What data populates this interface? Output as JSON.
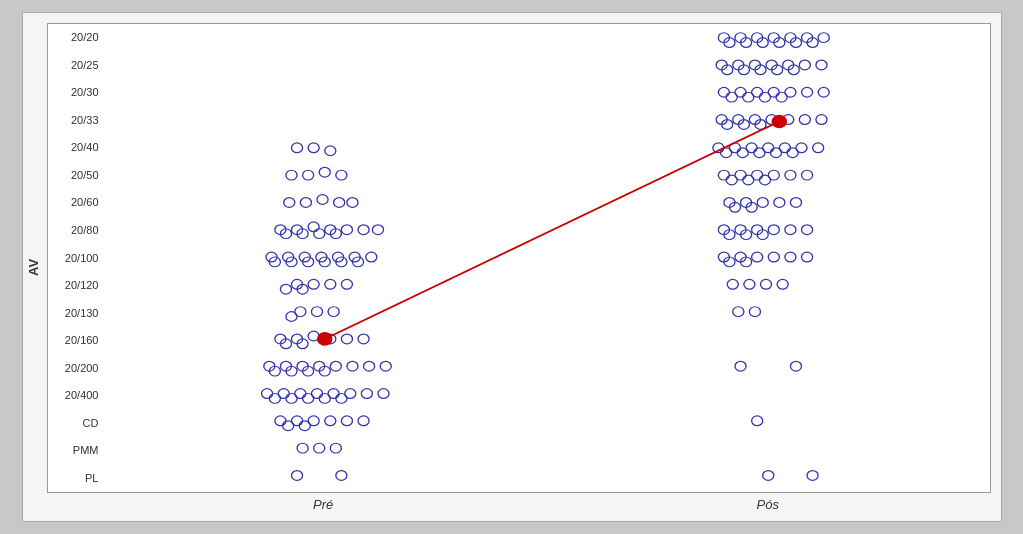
{
  "chart": {
    "title": "",
    "y_axis_label": "AV",
    "x_labels": [
      "Pré",
      "Pós"
    ],
    "y_levels": [
      "20/20",
      "20/25",
      "20/30",
      "20/33",
      "20/40",
      "20/50",
      "20/60",
      "20/80",
      "20/100",
      "20/120",
      "20/130",
      "20/160",
      "20/200",
      "20/400",
      "CD",
      "PMM",
      "PL"
    ],
    "mean_pre_level": "20/160",
    "mean_pos_level": "20/33",
    "colors": {
      "dot_stroke": "#3333aa",
      "mean_fill": "#cc0000",
      "mean_line": "#cc0000"
    }
  }
}
